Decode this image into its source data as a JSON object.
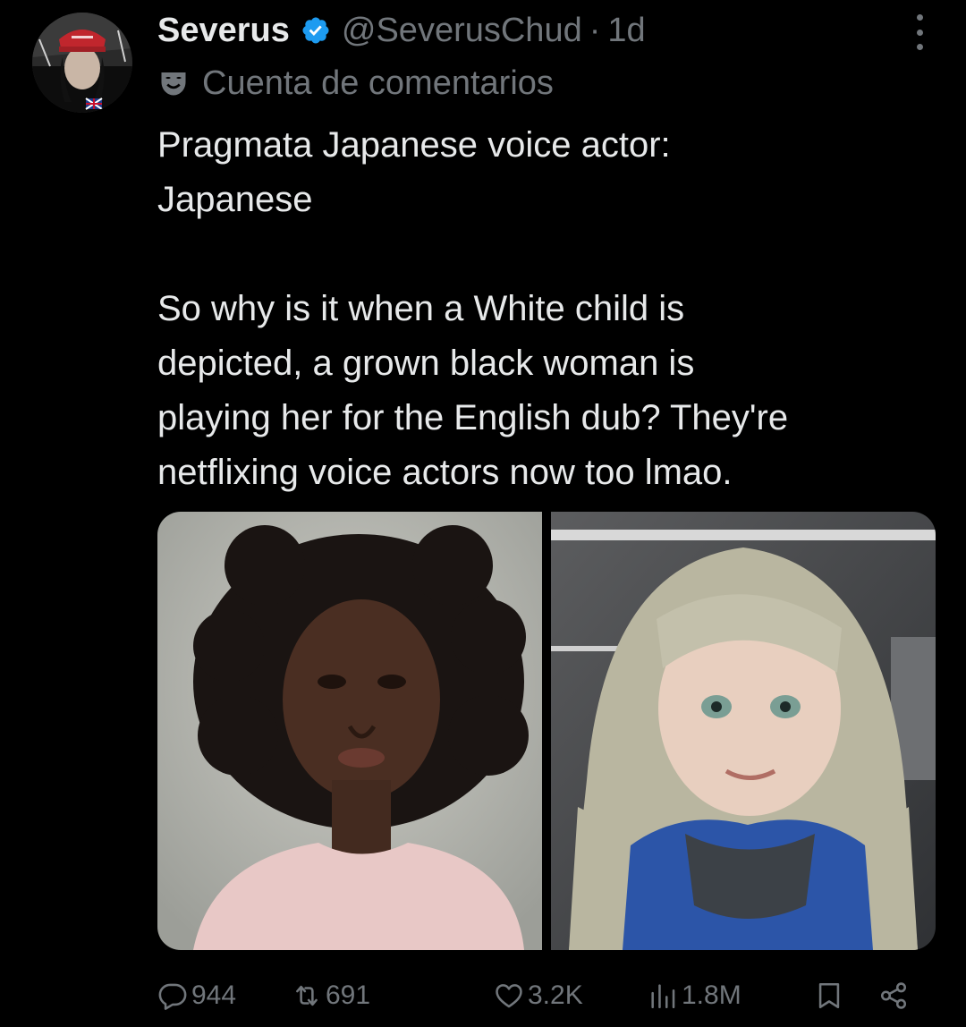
{
  "author": {
    "display_name": "Severus",
    "handle": "@SeverusChud",
    "separator": "·",
    "time": "1d",
    "label": "Cuenta de comentarios"
  },
  "tweet": {
    "line1": "Pragmata Japanese voice actor:",
    "line2": "Japanese",
    "line3": "So why is it when a White child is",
    "line4": "depicted, a grown black woman is",
    "line5": "playing her for the English dub? They're",
    "line6": "netflixing voice actors now too lmao."
  },
  "actions": {
    "replies": "944",
    "reposts": "691",
    "likes": "3.2K",
    "views": "1.8M"
  },
  "colors": {
    "background": "#000000",
    "text_primary": "#e7e9ea",
    "text_secondary": "#71767b",
    "verified_blue": "#1d9bf0"
  }
}
